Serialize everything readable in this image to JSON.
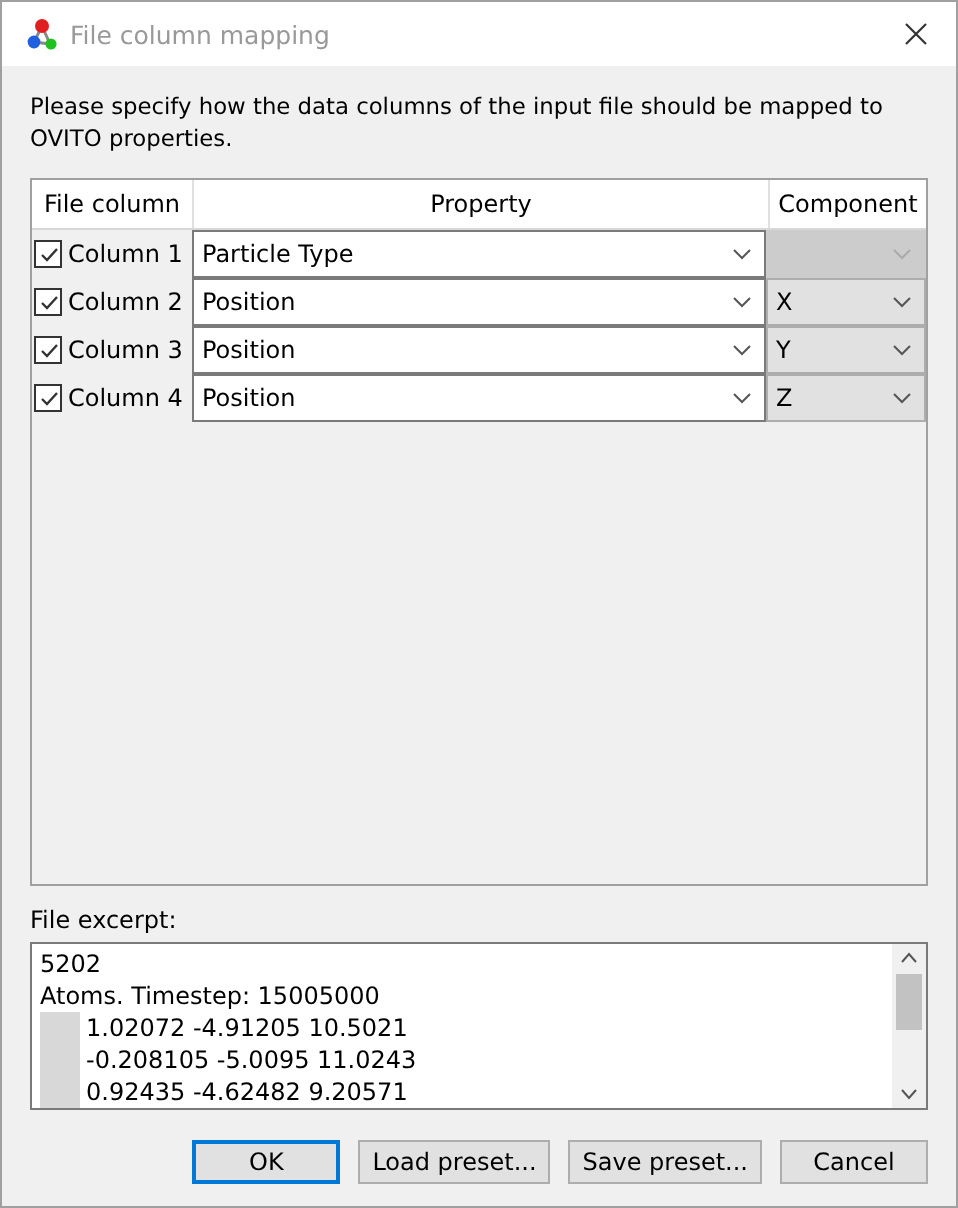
{
  "window": {
    "title": "File column mapping"
  },
  "instructions": "Please specify how the data columns of the input file should be mapped to OVITO properties.",
  "table": {
    "columns": [
      "File column",
      "Property",
      "Component"
    ],
    "rows": [
      {
        "checked": true,
        "column": "Column 1",
        "property": "Particle Type",
        "component": "",
        "component_disabled": true
      },
      {
        "checked": true,
        "column": "Column 2",
        "property": "Position",
        "component": "X",
        "component_disabled": false
      },
      {
        "checked": true,
        "column": "Column 3",
        "property": "Position",
        "component": "Y",
        "component_disabled": false
      },
      {
        "checked": true,
        "column": "Column 4",
        "property": "Position",
        "component": "Z",
        "component_disabled": false
      }
    ]
  },
  "excerpt": {
    "label": "File excerpt:",
    "lines": [
      {
        "text": "5202",
        "redacted": false
      },
      {
        "text": "Atoms. Timestep: 15005000",
        "redacted": false
      },
      {
        "text": "1.02072 -4.91205 10.5021",
        "redacted": true
      },
      {
        "text": "-0.208105 -5.0095 11.0243",
        "redacted": true
      },
      {
        "text": "0.92435 -4.62482 9.20571",
        "redacted": true
      }
    ]
  },
  "buttons": [
    {
      "label": "OK",
      "default": true
    },
    {
      "label": "Load preset...",
      "default": false
    },
    {
      "label": "Save preset...",
      "default": false
    },
    {
      "label": "Cancel",
      "default": false
    }
  ]
}
